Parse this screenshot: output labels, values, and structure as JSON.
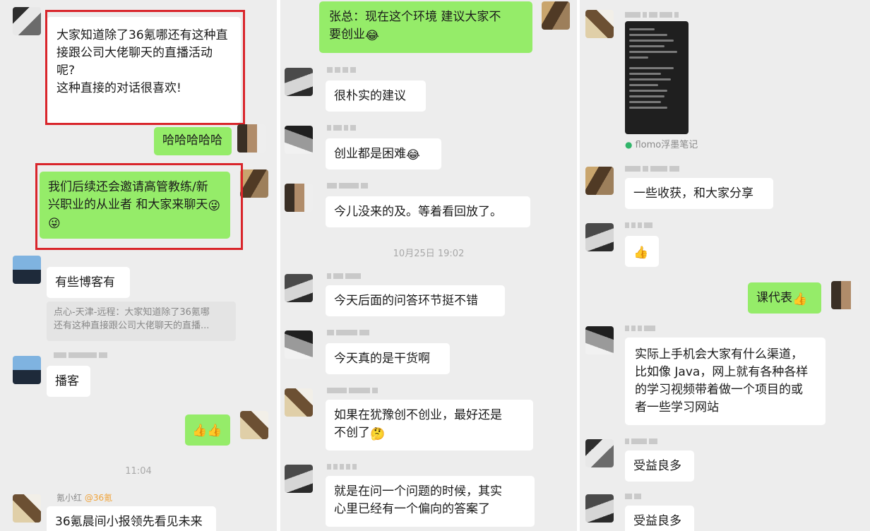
{
  "panel1": {
    "messages": {
      "m1": "大家知道除了36氪哪还有这种直\n接跟公司大佬聊天的直播活动\n呢?\n这种直接的对话很喜欢!",
      "m2": "哈哈哈哈哈",
      "m3": "我们后续还会邀请高管教练/新\n兴职业的从业者 和大家来聊天",
      "m4": "有些博客有",
      "quote": "点心-天津-远程：大家知道除了36氪哪\n还有这种直接跟公司大佬聊天的直播...",
      "m5": "播客",
      "m6_emoji": "👍👍",
      "time": "11:04",
      "sender_name": "氪小红",
      "sender_tag": "@36氪",
      "m7": "36氪晨间小报领先看见未来"
    }
  },
  "panel2": {
    "messages": {
      "m1": "张总：现在这个环境 建议大家不\n要创业",
      "m2": "很朴实的建议",
      "m3": "创业都是困难",
      "m4": "今儿没来的及。等着看回放了。",
      "time": "10月25日 19:02",
      "m5": "今天后面的问答环节挺不错",
      "m6": "今天真的是干货啊",
      "m7": "如果在犹豫创不创业，最好还是\n不创了",
      "m8": "就是在问一个问题的时候，其实\n心里已经有一个偏向的答案了"
    }
  },
  "panel3": {
    "messages": {
      "flomo": "flomo浮墨笔记",
      "m1": "一些收获，和大家分享",
      "m2_emoji": "👍",
      "m3": "课代表",
      "m4": "实际上手机会大家有什么渠道，\n比如像 Java，网上就有各种各样\n的学习视频带着做一个项目的或\n者一些学习网站",
      "m5": "受益良多",
      "m6": "受益良多"
    }
  },
  "icons": {
    "laugh_cry": "😂",
    "thumbs": "👍",
    "wink": "😜",
    "think": "🤔"
  },
  "colors": {
    "chat_bg": "#ededed",
    "bubble_green": "#95ec69",
    "bubble_white": "#ffffff",
    "highlight_red": "#d9252b",
    "mention_orange": "#f0a33a"
  }
}
